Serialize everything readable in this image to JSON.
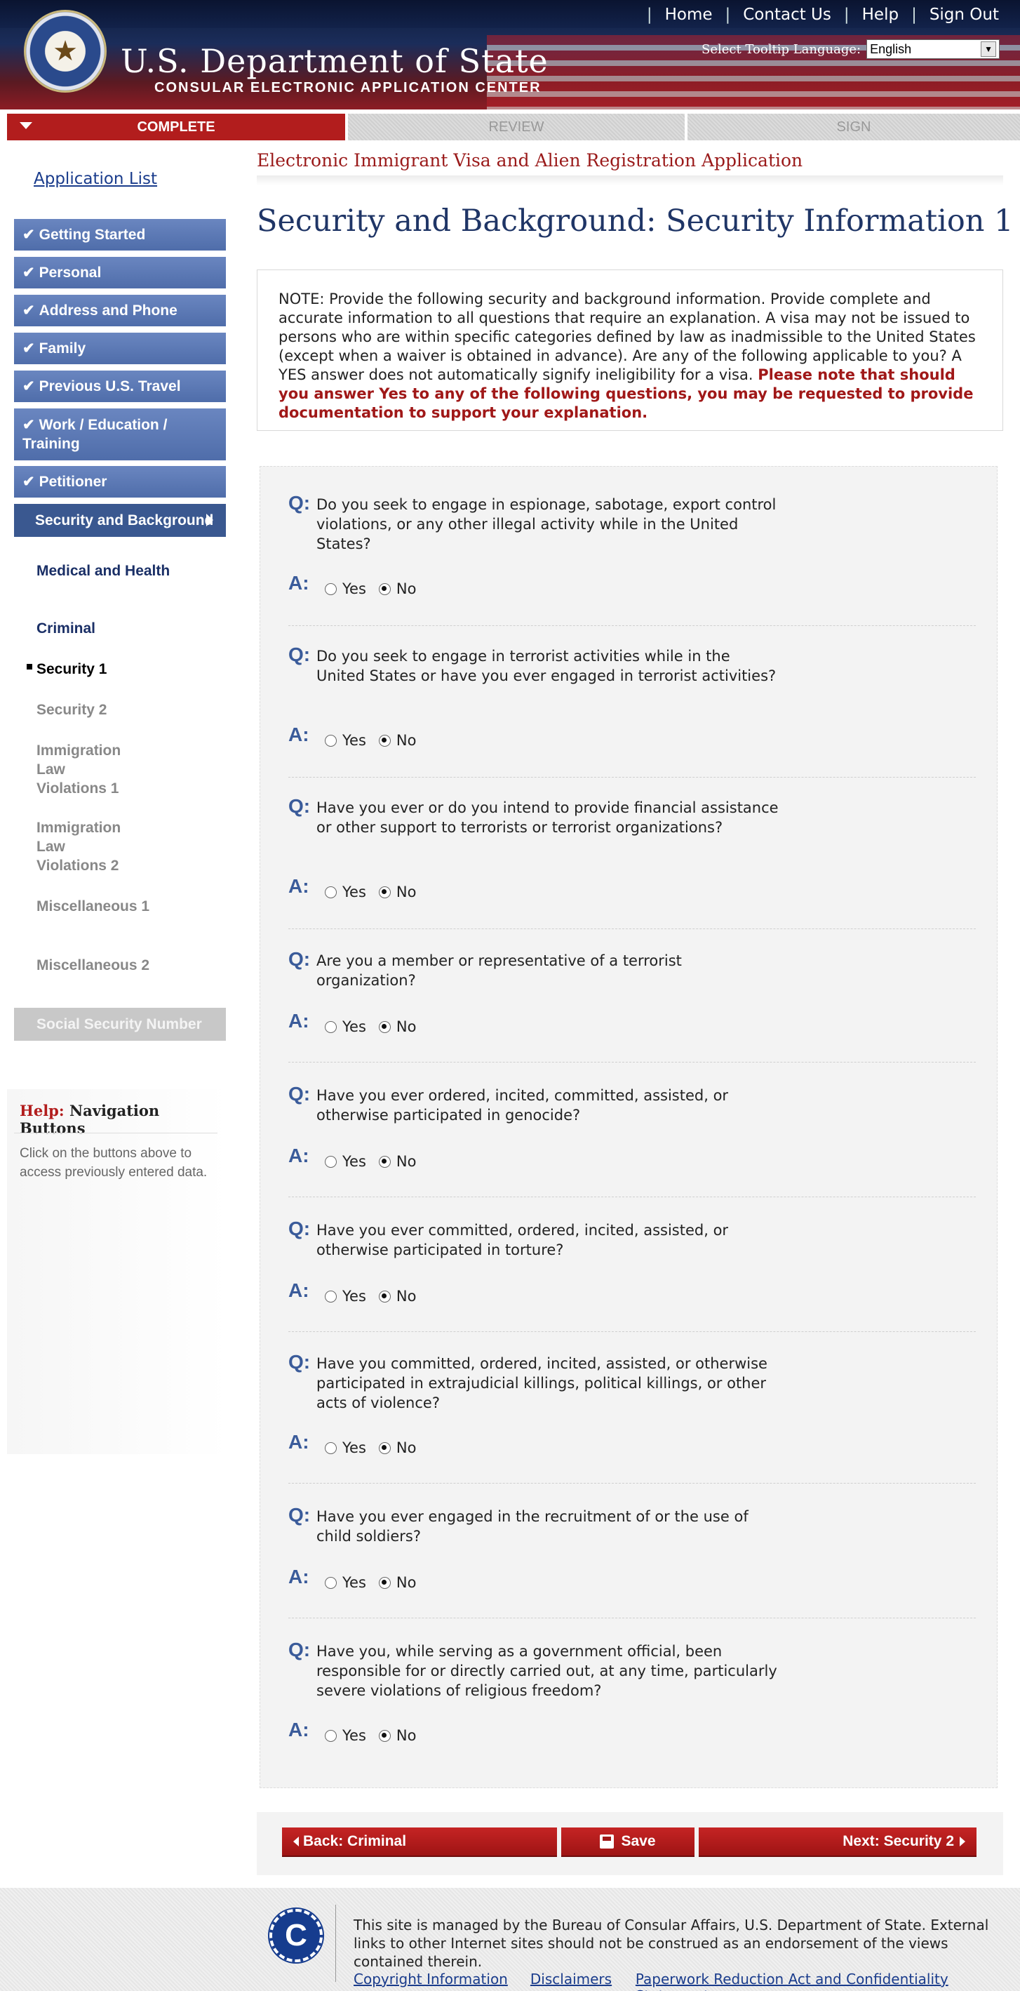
{
  "header": {
    "links": [
      "Home",
      "Contact Us",
      "Help",
      "Sign Out"
    ],
    "title": "U.S. Department of State",
    "subtitle": "CONSULAR ELECTRONIC APPLICATION CENTER",
    "tooltip_label": "Select Tooltip Language:",
    "tooltip_value": "English"
  },
  "steps": {
    "complete": "COMPLETE",
    "review": "REVIEW",
    "sign": "SIGN"
  },
  "sidebar": {
    "app_list": "Application List",
    "items": [
      "Getting Started",
      "Personal",
      "Address and Phone",
      "Family",
      "Previous U.S. Travel",
      "Work / Education / Training",
      "Petitioner"
    ],
    "current": "Security and Background",
    "subitems": [
      "Medical and Health",
      "Criminal",
      "Security 1",
      "Security 2",
      "Immigration Law Violations 1",
      "Immigration Law Violations 2",
      "Miscellaneous 1",
      "Miscellaneous 2"
    ],
    "disabled": "Social Security Number",
    "help": {
      "prefix": "Help:",
      "title": "Navigation Buttons",
      "text": "Click on the buttons above to access previously entered data."
    }
  },
  "main": {
    "form_title": "Electronic Immigrant Visa and Alien Registration Application",
    "heading": "Security and Background: Security Information 1",
    "note": "NOTE: Provide the following security and background information. Provide complete and accurate information to all questions that require an explanation. A visa may not be issued to persons who are within specific categories defined by law as inadmissible to the United States (except when a waiver is obtained in advance). Are any of the following applicable to you? A YES answer does not automatically signify ineligibility for a visa.",
    "note_emphasis": "Please note that should you answer Yes to any of the following questions, you may be requested to provide documentation to support your explanation.",
    "q_label": "Q:",
    "a_label": "A:",
    "yes": "Yes",
    "no": "No",
    "questions": [
      {
        "text": "Do you seek to engage in espionage, sabotage, export control violations, or any other illegal activity while in the United States?",
        "answer": "No"
      },
      {
        "text": "Do you seek to engage in terrorist activities while in the United States or have you ever engaged in terrorist activities?",
        "answer": "No"
      },
      {
        "text": "Have you ever or do you intend to provide financial assistance or other support to terrorists or terrorist organizations?",
        "answer": "No"
      },
      {
        "text": "Are you a member or representative of a terrorist organization?",
        "answer": "No"
      },
      {
        "text": "Have you ever ordered, incited, committed, assisted, or otherwise participated in genocide?",
        "answer": "No"
      },
      {
        "text": "Have you ever committed, ordered, incited, assisted, or otherwise participated in torture?",
        "answer": "No"
      },
      {
        "text": "Have you committed, ordered, incited, assisted, or otherwise participated in extrajudicial killings, political killings, or other acts of violence?",
        "answer": "No"
      },
      {
        "text": "Have you ever engaged in the recruitment of or the use of child soldiers?",
        "answer": "No"
      },
      {
        "text": "Have you, while serving as a government official, been responsible for or directly carried out, at any time, particularly severe violations of religious freedom?",
        "answer": "No"
      }
    ]
  },
  "buttons": {
    "back": "Back: Criminal",
    "save": "Save",
    "next": "Next: Security 2"
  },
  "footer": {
    "logo_letter": "C",
    "text": "This site is managed by the Bureau of Consular Affairs, U.S. Department of State. External links to other Internet sites should not be construed as an endorsement of the views contained therein.",
    "links": [
      "Copyright Information",
      "Disclaimers",
      "Paperwork Reduction Act and Confidentiality Statement"
    ]
  },
  "colors": {
    "accent_red": "#b21d1d",
    "nav_blue": "#4f6daa",
    "heading_blue": "#1f3566"
  }
}
